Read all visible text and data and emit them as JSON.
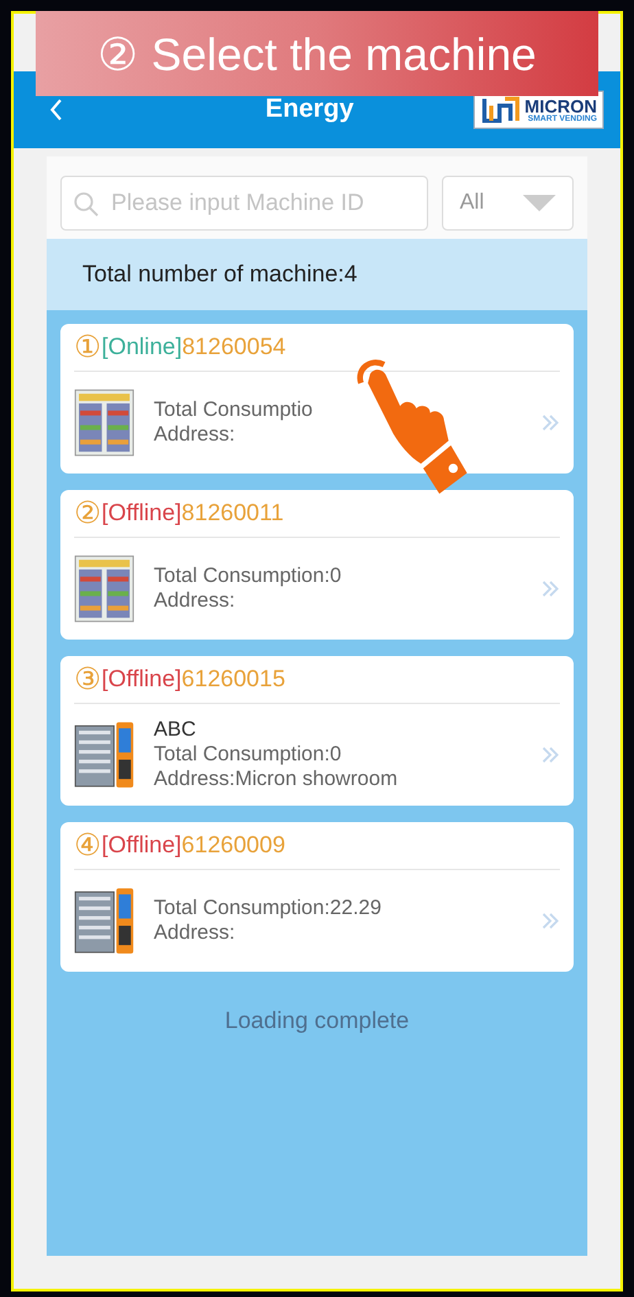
{
  "banner": {
    "number": "②",
    "text": "Select the machine"
  },
  "header": {
    "title": "Energy",
    "logo": {
      "name": "MICRON",
      "tagline": "SMART VENDING"
    }
  },
  "search": {
    "placeholder": "Please input Machine ID",
    "filter": "All"
  },
  "total": "Total number of machine:4",
  "machines": [
    {
      "index": "①",
      "online": true,
      "status": "[Online]",
      "id": "81260054",
      "kind": "snack",
      "consumption": "Total Consumptio",
      "address": "Address:"
    },
    {
      "index": "②",
      "online": false,
      "status": "[Offline]",
      "id": "81260011",
      "kind": "snack",
      "consumption": "Total Consumption:0",
      "address": "Address:"
    },
    {
      "index": "③",
      "online": false,
      "status": "[Offline]",
      "id": "61260015",
      "kind": "combo",
      "name": "ABC",
      "consumption": "Total Consumption:0",
      "address": "Address:Micron showroom"
    },
    {
      "index": "④",
      "online": false,
      "status": "[Offline]",
      "id": "61260009",
      "kind": "combo",
      "consumption": "Total Consumption:22.29",
      "address": "Address:"
    }
  ],
  "footer": "Loading complete"
}
